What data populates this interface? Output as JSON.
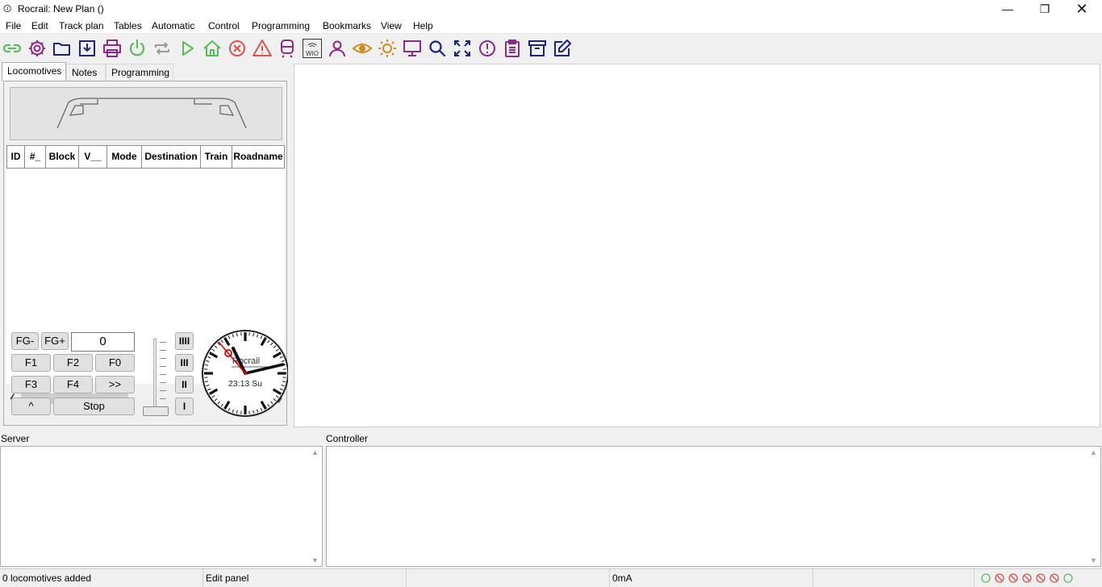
{
  "window": {
    "title": "Rocrail: New Plan ()",
    "app_icon": "rocrail-app-icon",
    "controls": [
      "minimize",
      "restore",
      "close"
    ]
  },
  "menubar": {
    "items": [
      {
        "label": "File"
      },
      {
        "label": "Edit"
      },
      {
        "label": "Track plan"
      },
      {
        "label": "Tables"
      },
      {
        "label": "Automatic"
      },
      {
        "label": "Control"
      },
      {
        "label": "Programming"
      },
      {
        "label": "Bookmarks"
      },
      {
        "label": "View"
      },
      {
        "label": "Help"
      }
    ]
  },
  "toolbar": {
    "icons": [
      {
        "name": "connect-icon",
        "color": "#5cb85c"
      },
      {
        "name": "settings-icon",
        "color": "#8b2a8b"
      },
      {
        "name": "open-folder-icon",
        "color": "#1a237e"
      },
      {
        "name": "save-icon",
        "color": "#1a237e"
      },
      {
        "name": "print-icon",
        "color": "#8b2a8b"
      },
      {
        "name": "power-icon",
        "color": "#5cb85c"
      },
      {
        "name": "repeat-icon",
        "color": "#999999"
      },
      {
        "name": "play-icon",
        "color": "#5cb85c"
      },
      {
        "name": "home-icon",
        "color": "#5cb85c"
      },
      {
        "name": "stop-icon",
        "color": "#d9534f"
      },
      {
        "name": "warning-icon",
        "color": "#d9534f"
      },
      {
        "name": "train-icon",
        "color": "#8b2a8b"
      },
      {
        "name": "wio-icon",
        "color": "#333333"
      },
      {
        "name": "user-icon",
        "color": "#8b2a8b"
      },
      {
        "name": "eye-icon",
        "color": "#d08a1b"
      },
      {
        "name": "sun-icon",
        "color": "#d08a1b"
      },
      {
        "name": "monitor-icon",
        "color": "#8b2a8b"
      },
      {
        "name": "search-icon",
        "color": "#1a237e"
      },
      {
        "name": "fullscreen-icon",
        "color": "#1a237e"
      },
      {
        "name": "info-icon",
        "color": "#8b2a8b"
      },
      {
        "name": "clipboard-icon",
        "color": "#8b2a8b"
      },
      {
        "name": "archive-icon",
        "color": "#1a237e"
      },
      {
        "name": "edit-icon",
        "color": "#1a237e"
      }
    ],
    "wio_text": "WIO"
  },
  "left_panel": {
    "tabs": [
      {
        "label": "Locomotives",
        "active": true
      },
      {
        "label": "Notes",
        "active": false
      },
      {
        "label": "Programming",
        "active": false
      }
    ],
    "grid": {
      "columns": [
        "ID",
        "#_",
        "Block",
        "V__",
        "Mode",
        "Destination",
        "Train",
        "Roadname"
      ],
      "rows": []
    },
    "throttle": {
      "fg_minus": "FG-",
      "fg_plus": "FG+",
      "speed_value": "0",
      "f1": "F1",
      "f2": "F2",
      "f0": "F0",
      "f3": "F3",
      "f4": "F4",
      "more": ">>",
      "direction": "^",
      "stop": "Stop",
      "gears": [
        "IIII",
        "III",
        "II",
        "I"
      ]
    },
    "clock": {
      "brand": "Rocrail",
      "time_text": "23:13 Su"
    }
  },
  "logs": {
    "server_label": "Server",
    "controller_label": "Controller"
  },
  "statusbar": {
    "message": "0 locomotives added",
    "mode": "Edit panel",
    "current": "0mA",
    "indicator_colors": {
      "ok": "#5cb85c",
      "blocked": "#d9534f"
    }
  }
}
